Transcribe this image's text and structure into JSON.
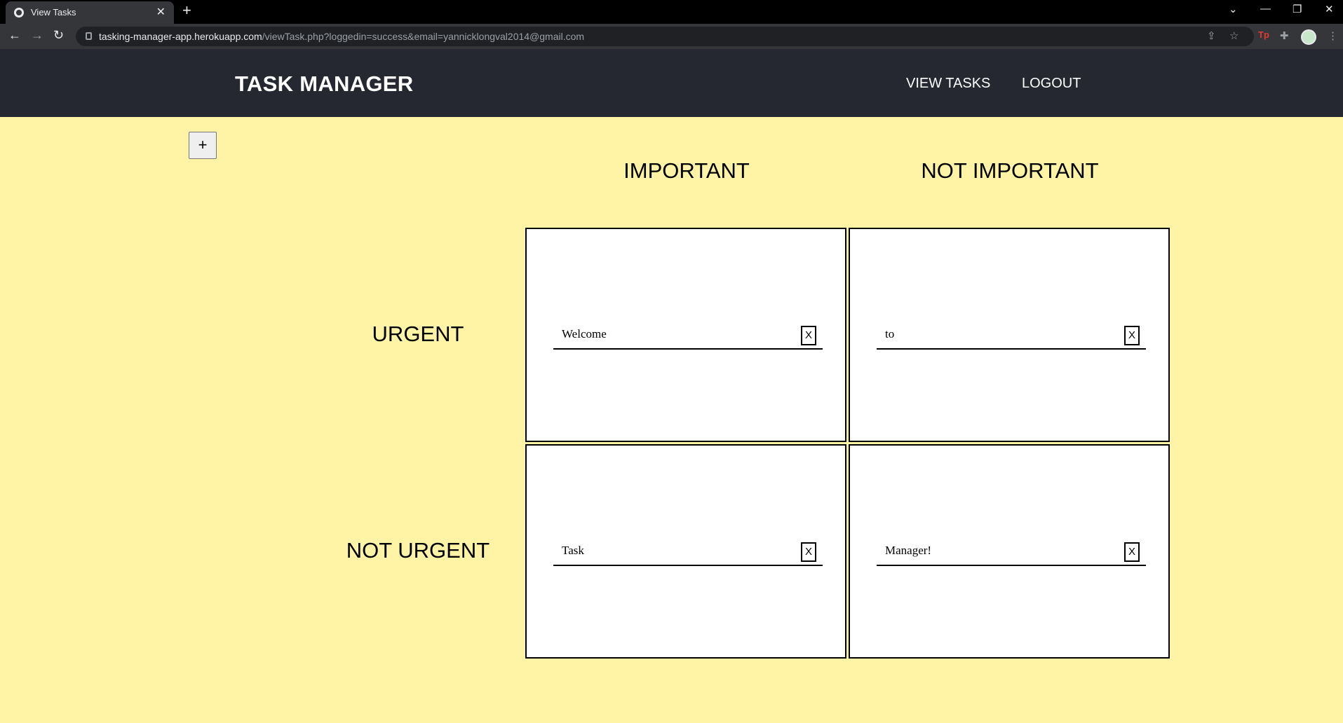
{
  "browser": {
    "tab_title": "View Tasks",
    "url_host": "tasking-manager-app.herokuapp.com",
    "url_path": "/viewTask.php?loggedin=success&email=yannicklongval2014@gmail.com"
  },
  "header": {
    "brand": "TASK MANAGER",
    "nav": {
      "view_tasks": "VIEW TASKS",
      "logout": "LOGOUT"
    }
  },
  "toolbar": {
    "add_label": "+"
  },
  "matrix": {
    "columns": [
      "IMPORTANT",
      "NOT IMPORTANT"
    ],
    "rows": [
      "URGENT",
      "NOT URGENT"
    ],
    "cells": [
      {
        "task": "Welcome",
        "delete_label": "X"
      },
      {
        "task": "to",
        "delete_label": "X"
      },
      {
        "task": "Task",
        "delete_label": "X"
      },
      {
        "task": "Manager!",
        "delete_label": "X"
      }
    ]
  }
}
